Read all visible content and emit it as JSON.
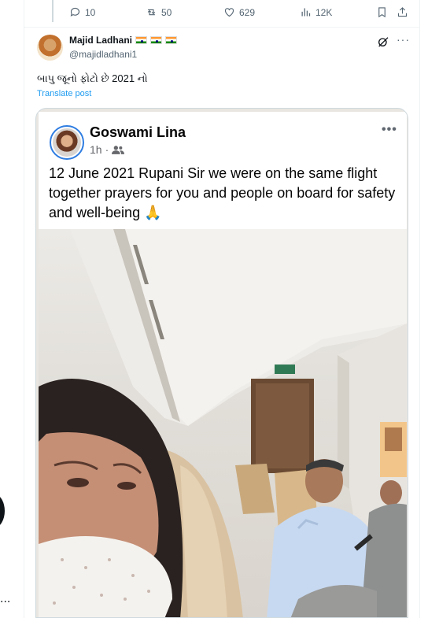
{
  "previous_tweet": {
    "replies": "10",
    "retweets": "50",
    "likes": "629",
    "views": "12K"
  },
  "tweet": {
    "author_name": "Majid Ladhani",
    "author_handle": "@majidladhani1",
    "text": "બાપુ જૂનો ફોટો છે 2021 નો",
    "translate_label": "Translate post",
    "more_label": "···"
  },
  "embedded_post": {
    "name": "Goswami Lina",
    "time": "1h",
    "more_label": "•••",
    "text": "12 June 2021 Rupani Sir we were on the same flight together prayers for you and people on board for safety and well-being 🙏"
  },
  "left_panel": {
    "more_label": "..."
  },
  "colors": {
    "link": "#1d9bf0",
    "muted": "#536471",
    "fb_ring": "#2f7de1"
  },
  "icons": [
    "reply-icon",
    "retweet-icon",
    "like-icon",
    "views-icon",
    "bookmark-icon",
    "share-icon",
    "grok-icon",
    "more-icon",
    "friends-icon"
  ]
}
